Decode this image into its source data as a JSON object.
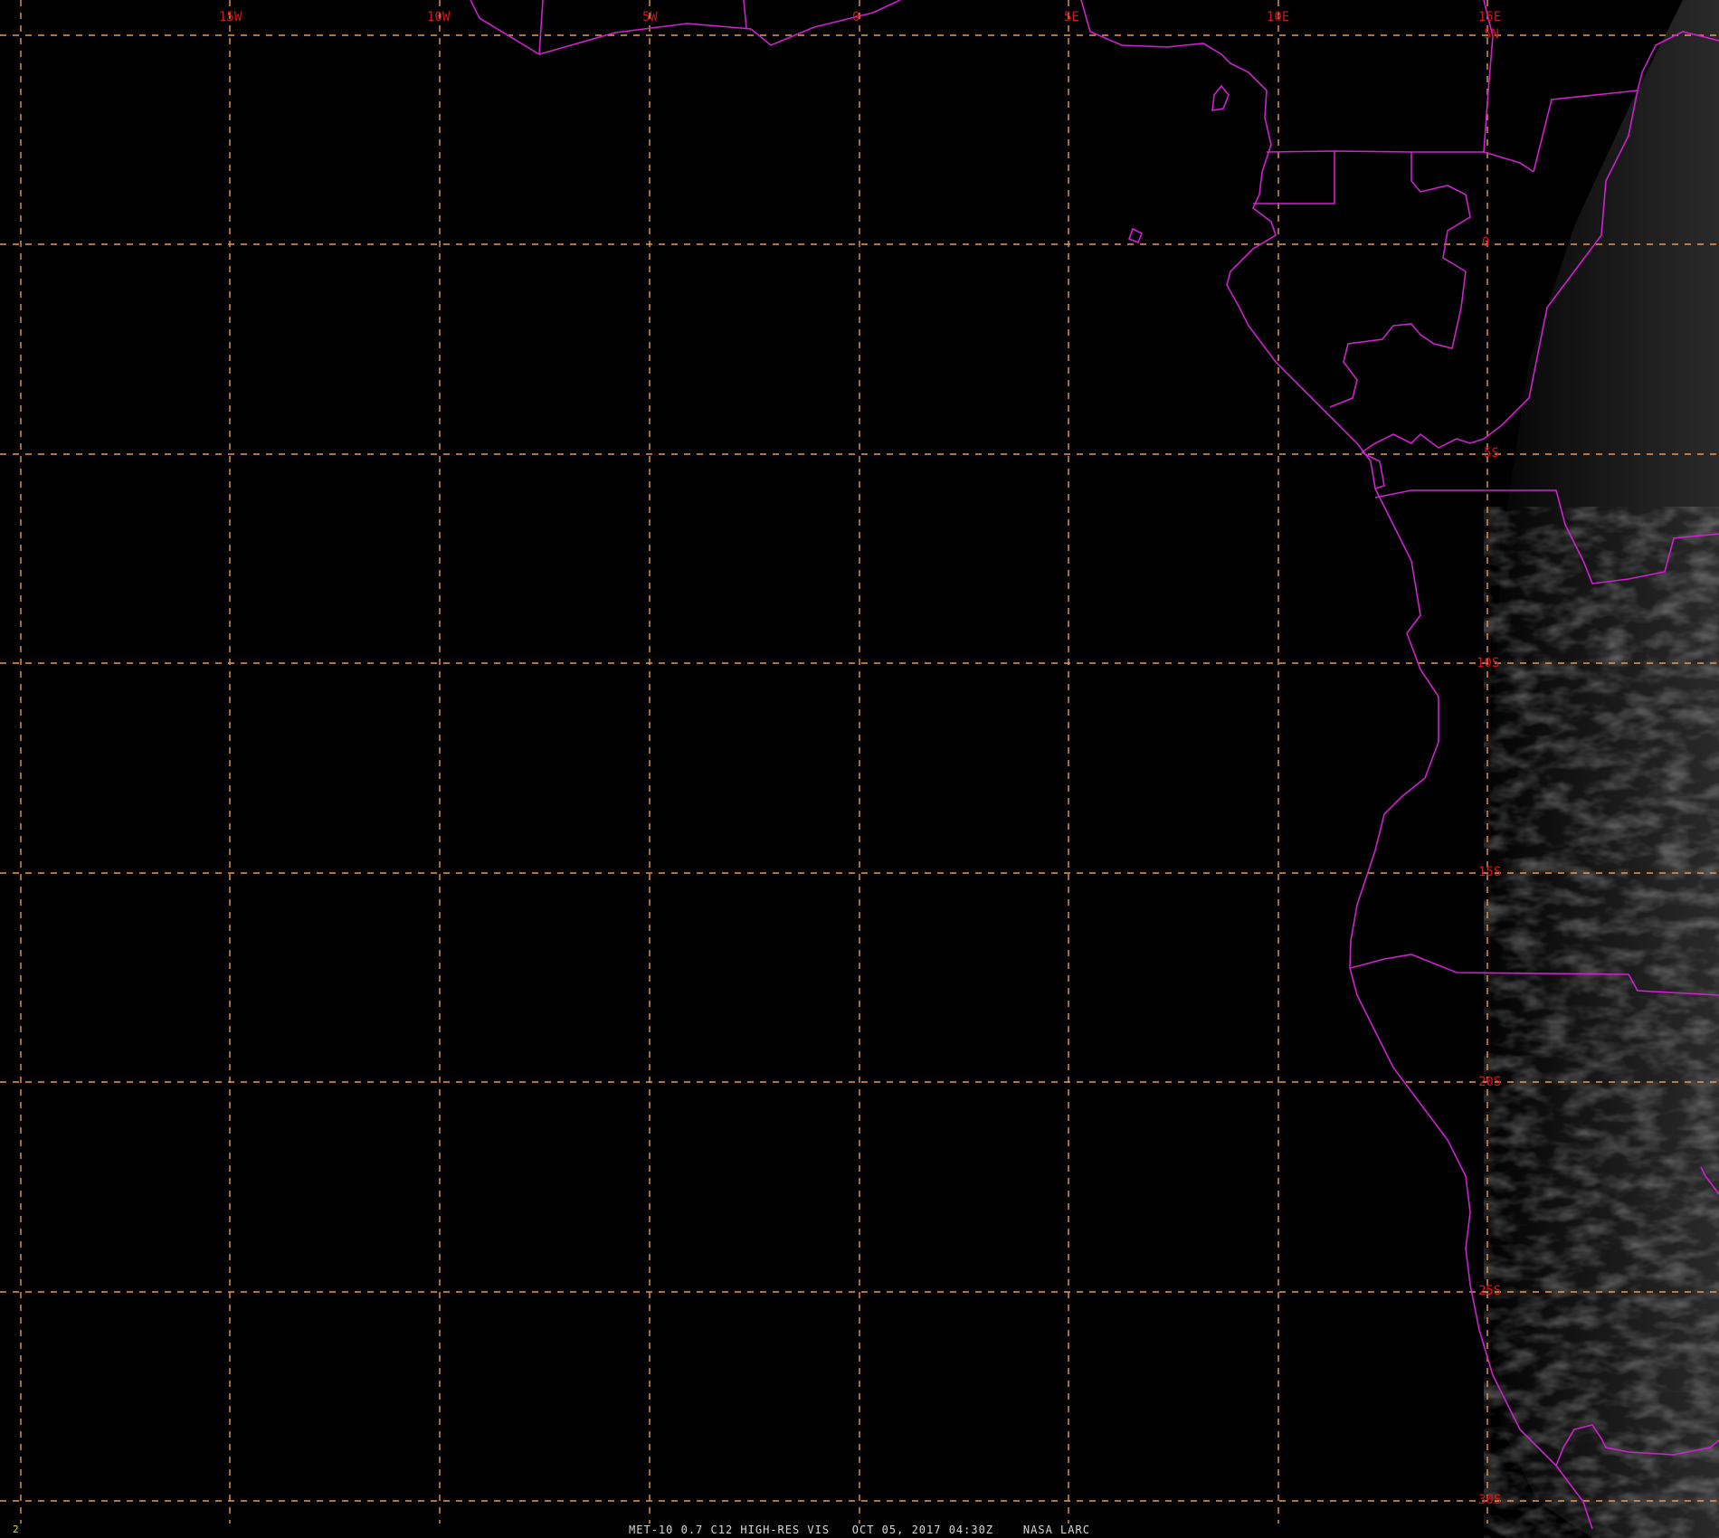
{
  "map": {
    "lon_labels": [
      "15W",
      "10W",
      "5W",
      "0",
      "5E",
      "10E",
      "15E"
    ],
    "lat_labels": [
      "5N",
      "0",
      "5S",
      "10S",
      "15S",
      "20S",
      "25S",
      "30S"
    ],
    "grid_color": "#e89a55",
    "label_color": "#d01818",
    "boundary_color": "#d020d0",
    "projection": "satellite visible imagery, lat/lon grid every 5 degrees"
  },
  "footer": {
    "frame_number": "2",
    "caption": "MET-10 0.7 C12 HIGH-RES VIS   OCT 05, 2017 04:30Z    NASA LARC"
  }
}
